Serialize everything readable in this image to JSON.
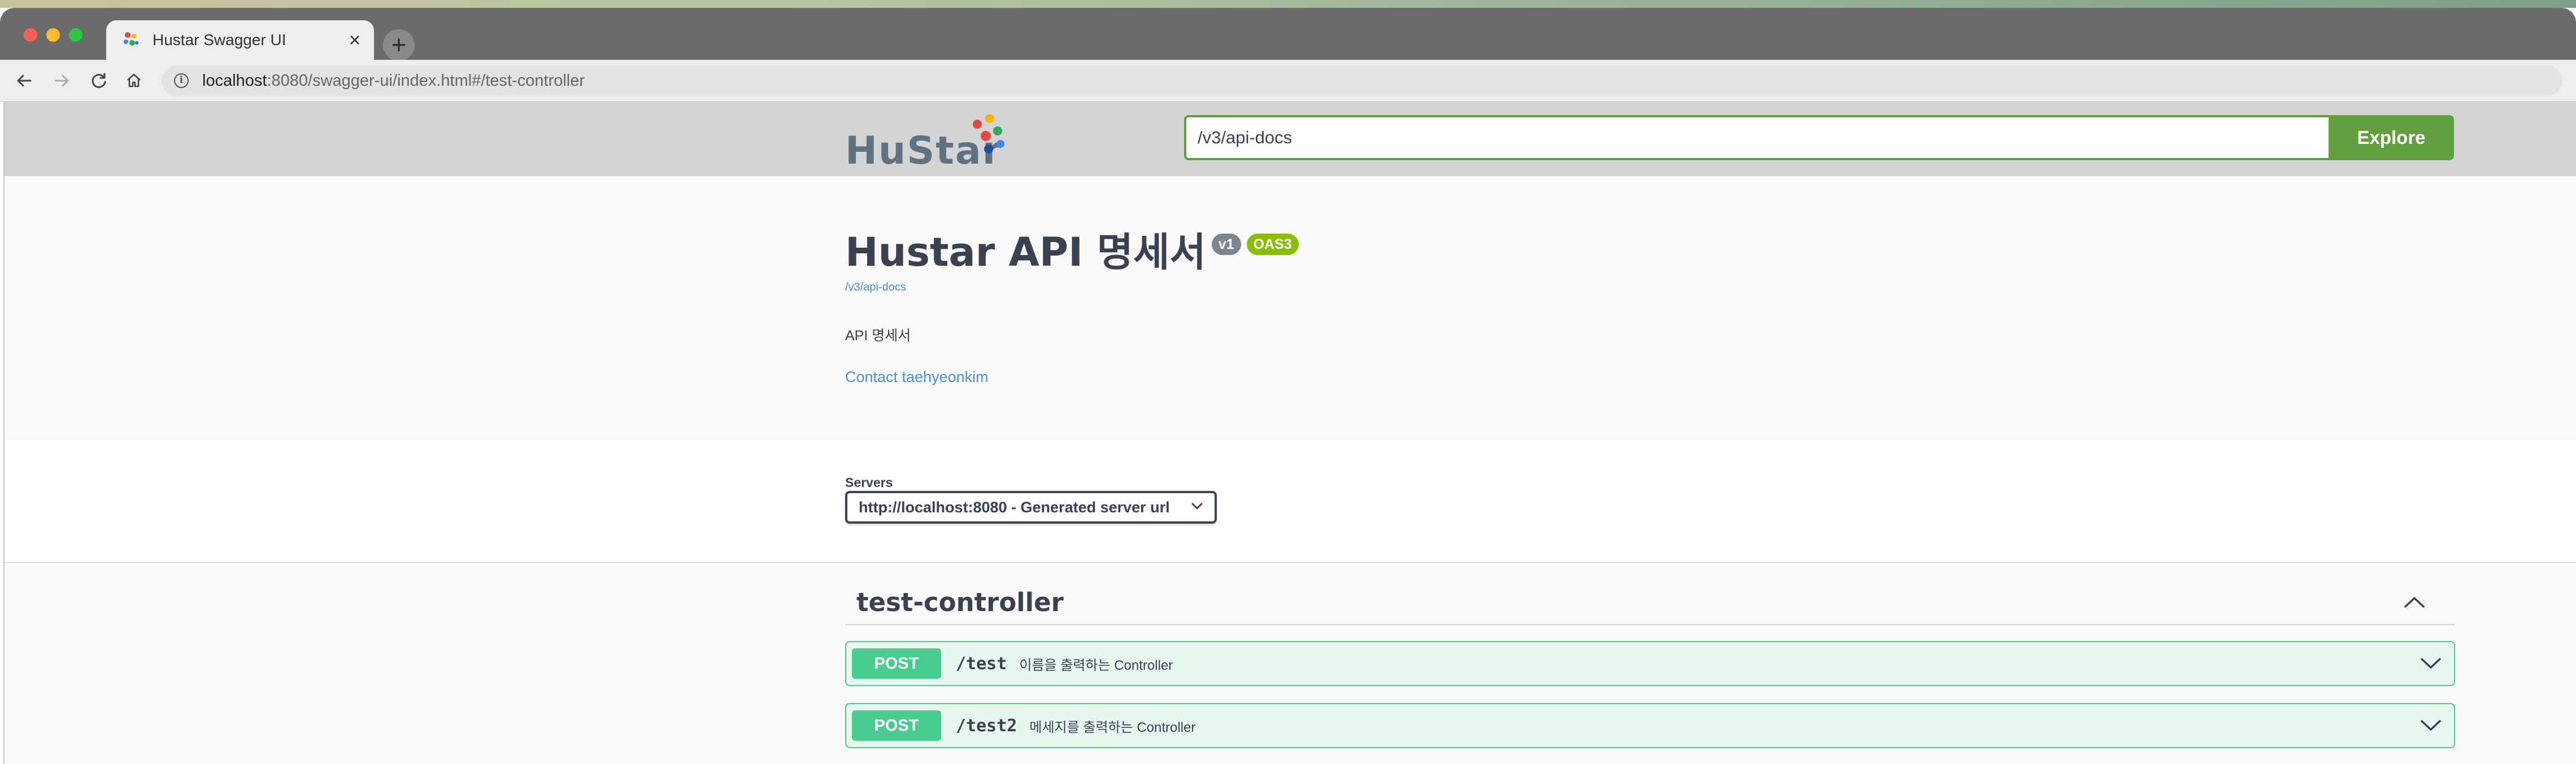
{
  "browser": {
    "tab_title": "Hustar Swagger UI",
    "tab_close": "×",
    "new_tab": "+",
    "url_host": "localhost",
    "url_rest": ":8080/swagger-ui/index.html#/test-controller"
  },
  "topbar": {
    "logo_text": "HuStar",
    "spec_url": "/v3/api-docs",
    "explore_label": "Explore",
    "accent_color": "#62a03f"
  },
  "info": {
    "title": "Hustar API 명세서",
    "version_badge": "v1",
    "oas_badge": "OAS3",
    "doc_link": "/v3/api-docs",
    "description": "API 명세서",
    "contact": "Contact taehyeonkim"
  },
  "servers": {
    "label": "Servers",
    "selected": "http://localhost:8080 - Generated server url"
  },
  "operations": {
    "tag": "test-controller",
    "items": [
      {
        "method": "POST",
        "path": "/test",
        "summary": "이름을 출력하는 Controller"
      },
      {
        "method": "POST",
        "path": "/test2",
        "summary": "메세지를 출력하는 Controller"
      }
    ],
    "post_color": "#49cc90"
  }
}
